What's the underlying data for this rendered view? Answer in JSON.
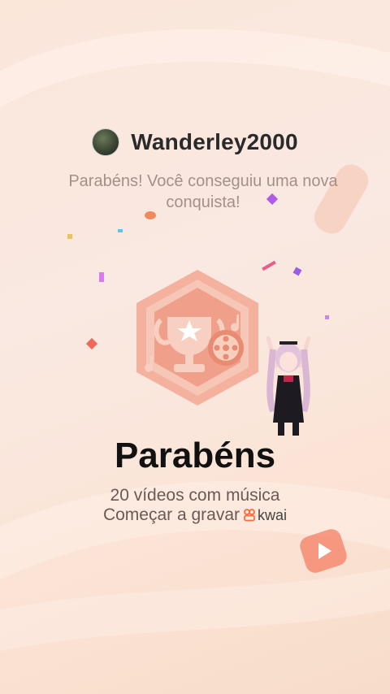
{
  "user": {
    "username": "Wanderley2000"
  },
  "message": {
    "subtitle": "Parabéns! Você conseguiu uma nova conquista!"
  },
  "achievement": {
    "title": "Parabéns",
    "description": "20 vídeos com música",
    "cta": "Começar a gravar",
    "brand": "kwai"
  },
  "colors": {
    "badge": "#f0a08a",
    "badge_dark": "#e07d66",
    "accent": "#ff6a3d"
  }
}
